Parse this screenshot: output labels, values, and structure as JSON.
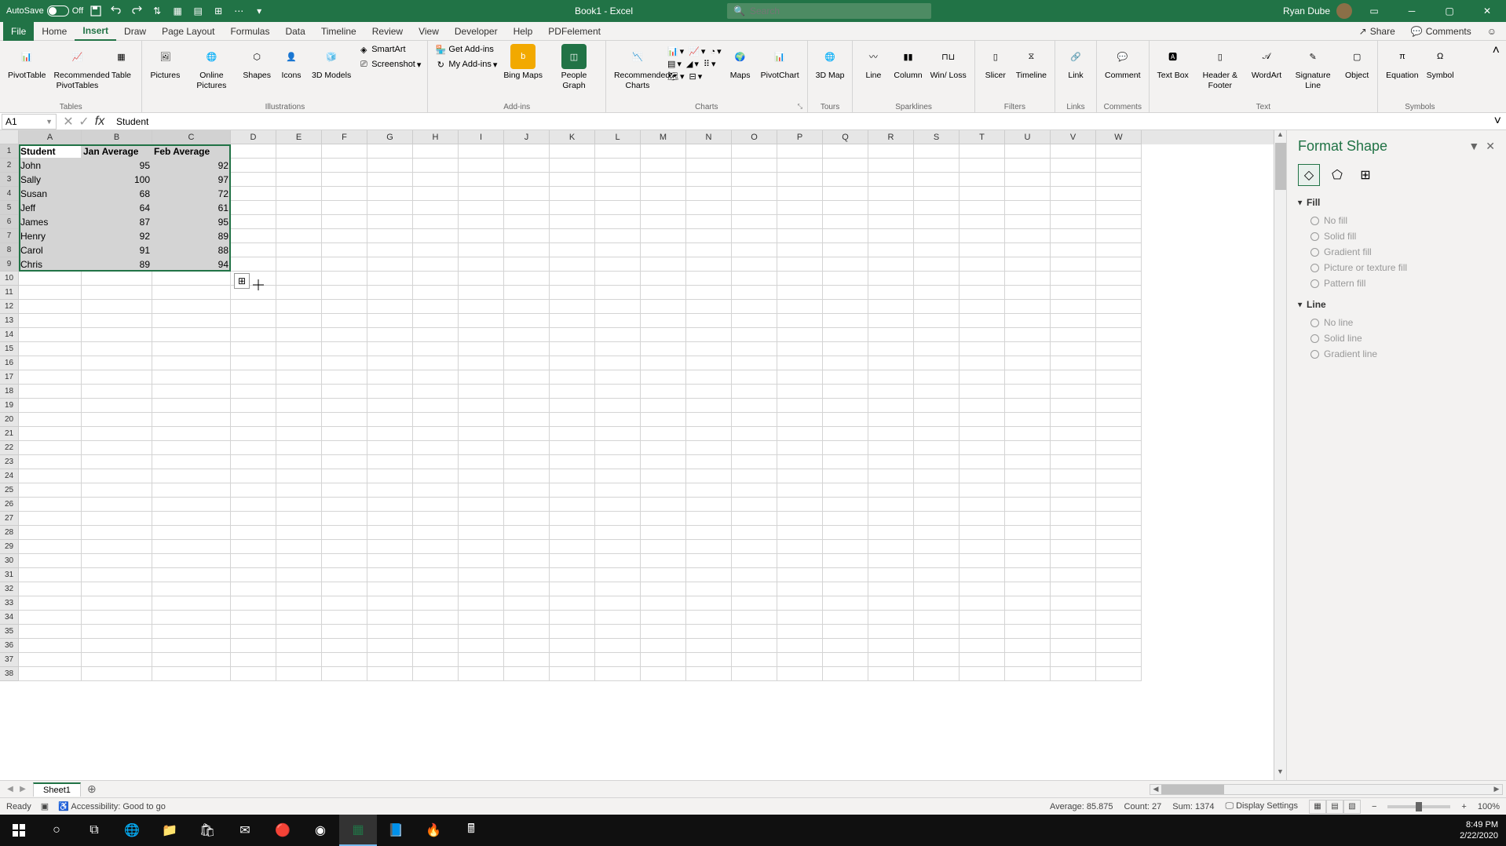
{
  "titlebar": {
    "autosave_label": "AutoSave",
    "autosave_state": "Off",
    "doc_title": "Book1 - Excel",
    "search_placeholder": "Search",
    "user_name": "Ryan Dube"
  },
  "menu": {
    "tabs": [
      "File",
      "Home",
      "Insert",
      "Draw",
      "Page Layout",
      "Formulas",
      "Data",
      "Timeline",
      "Review",
      "View",
      "Developer",
      "Help",
      "PDFelement"
    ],
    "active": "Insert",
    "share": "Share",
    "comments": "Comments"
  },
  "ribbon": {
    "groups": {
      "tables": {
        "label": "Tables",
        "items": [
          "PivotTable",
          "Recommended\nPivotTables",
          "Table"
        ]
      },
      "illustrations": {
        "label": "Illustrations",
        "items": [
          "Pictures",
          "Online\nPictures",
          "Shapes",
          "Icons",
          "3D\nModels"
        ],
        "small": [
          "SmartArt",
          "Screenshot"
        ]
      },
      "addins": {
        "label": "Add-ins",
        "items": [
          "Get Add-ins",
          "My Add-ins",
          "Bing\nMaps",
          "People\nGraph"
        ]
      },
      "charts": {
        "label": "Charts",
        "items": [
          "Recommended\nCharts",
          "Maps",
          "PivotChart"
        ]
      },
      "tours": {
        "label": "Tours",
        "items": [
          "3D\nMap"
        ]
      },
      "sparklines": {
        "label": "Sparklines",
        "items": [
          "Line",
          "Column",
          "Win/\nLoss"
        ]
      },
      "filters": {
        "label": "Filters",
        "items": [
          "Slicer",
          "Timeline"
        ]
      },
      "links": {
        "label": "Links",
        "items": [
          "Link"
        ]
      },
      "comments": {
        "label": "Comments",
        "items": [
          "Comment"
        ]
      },
      "text": {
        "label": "Text",
        "items": [
          "Text\nBox",
          "Header\n& Footer",
          "WordArt",
          "Signature\nLine",
          "Object"
        ]
      },
      "symbols": {
        "label": "Symbols",
        "items": [
          "Equation",
          "Symbol"
        ]
      }
    }
  },
  "formula_bar": {
    "name_box": "A1",
    "formula": "Student"
  },
  "grid": {
    "columns": [
      "A",
      "B",
      "C",
      "D",
      "E",
      "F",
      "G",
      "H",
      "I",
      "J",
      "K",
      "L",
      "M",
      "N",
      "O",
      "P",
      "Q",
      "R",
      "S",
      "T",
      "U",
      "V",
      "W"
    ],
    "col_widths": {
      "A": 80,
      "B": 90,
      "C": 100,
      "default": 58
    },
    "selected_cols": [
      "A",
      "B",
      "C"
    ],
    "selected_rows": [
      1,
      2,
      3,
      4,
      5,
      6,
      7,
      8,
      9
    ],
    "headers": [
      "Student",
      "Jan Average",
      "Feb Average"
    ],
    "rows": [
      {
        "name": "John",
        "jan": 95,
        "feb": 92
      },
      {
        "name": "Sally",
        "jan": 100,
        "feb": 97
      },
      {
        "name": "Susan",
        "jan": 68,
        "feb": 72
      },
      {
        "name": "Jeff",
        "jan": 64,
        "feb": 61
      },
      {
        "name": "James",
        "jan": 87,
        "feb": 95
      },
      {
        "name": "Henry",
        "jan": 92,
        "feb": 89
      },
      {
        "name": "Carol",
        "jan": 91,
        "feb": 88
      },
      {
        "name": "Chris",
        "jan": 89,
        "feb": 94
      }
    ],
    "total_rows": 38,
    "active_cell": "A1"
  },
  "format_pane": {
    "title": "Format Shape",
    "sections": {
      "fill": {
        "label": "Fill",
        "options": [
          "No fill",
          "Solid fill",
          "Gradient fill",
          "Picture or texture fill",
          "Pattern fill"
        ]
      },
      "line": {
        "label": "Line",
        "options": [
          "No line",
          "Solid line",
          "Gradient line"
        ]
      }
    }
  },
  "sheets": {
    "tabs": [
      "Sheet1"
    ],
    "active": "Sheet1"
  },
  "status": {
    "ready": "Ready",
    "accessibility": "Accessibility: Good to go",
    "average": "Average: 85.875",
    "count": "Count: 27",
    "sum": "Sum: 1374",
    "display": "Display Settings",
    "zoom": "100%"
  },
  "taskbar": {
    "time": "8:49 PM",
    "date": "2/22/2020"
  }
}
